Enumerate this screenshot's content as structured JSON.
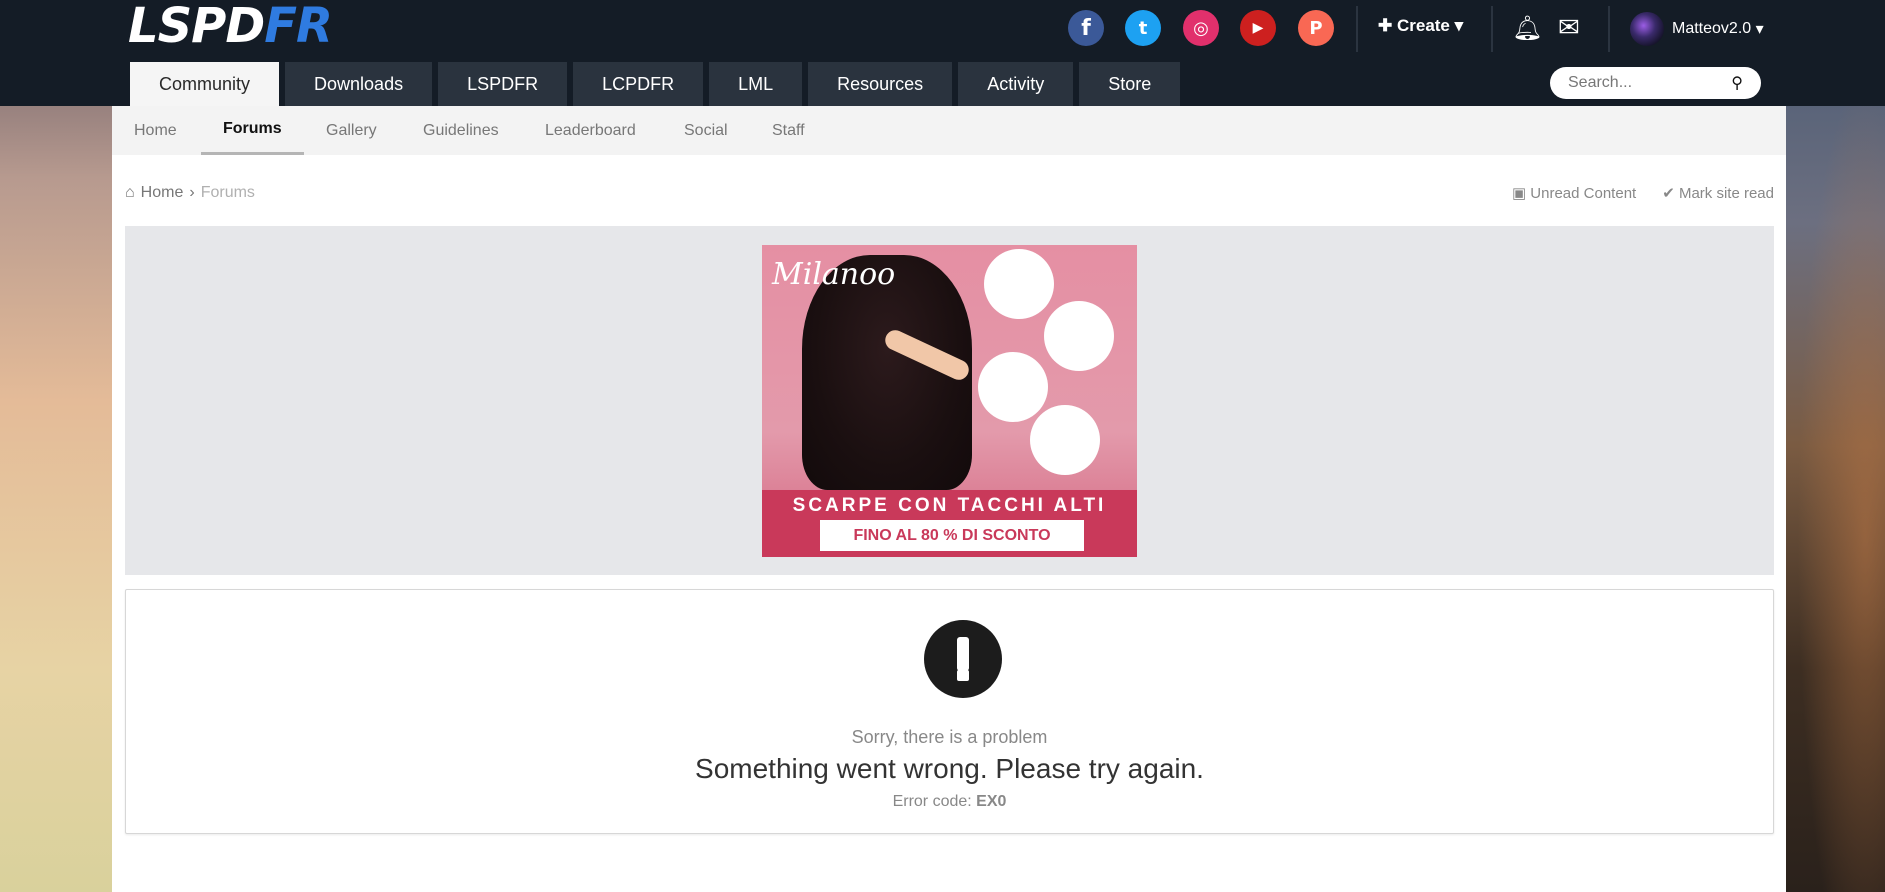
{
  "brand": {
    "part1": "LSPD",
    "part2": "FR"
  },
  "social": [
    {
      "name": "facebook-icon",
      "glyph": "f",
      "color": "#3b5998"
    },
    {
      "name": "twitter-icon",
      "glyph": "t",
      "color": "#1da1f2"
    },
    {
      "name": "instagram-icon",
      "glyph": "◎",
      "color": "#e1306c"
    },
    {
      "name": "youtube-icon",
      "glyph": "▶",
      "color": "#cd201f"
    },
    {
      "name": "patreon-icon",
      "glyph": "P",
      "color": "#f96854"
    }
  ],
  "header": {
    "create_label": "Create",
    "username": "Matteov2.0",
    "search_placeholder": "Search..."
  },
  "main_nav": [
    {
      "label": "Community"
    },
    {
      "label": "Downloads"
    },
    {
      "label": "LSPDFR"
    },
    {
      "label": "LCPDFR"
    },
    {
      "label": "LML"
    },
    {
      "label": "Resources"
    },
    {
      "label": "Activity"
    },
    {
      "label": "Store"
    }
  ],
  "sub_nav": [
    {
      "label": "Home"
    },
    {
      "label": "Forums"
    },
    {
      "label": "Gallery"
    },
    {
      "label": "Guidelines"
    },
    {
      "label": "Leaderboard"
    },
    {
      "label": "Social"
    },
    {
      "label": "Staff"
    }
  ],
  "breadcrumb": {
    "home": "Home",
    "current": "Forums"
  },
  "actions": {
    "unread": "Unread Content",
    "mark_read": "Mark site read"
  },
  "ad": {
    "brand": "Milanoo",
    "headline": "SCARPE CON TACCHI ALTI",
    "cta": "FINO AL 80 % DI SCONTO"
  },
  "error": {
    "heading": "Sorry, there is a problem",
    "message": "Something went wrong. Please try again.",
    "code_label": "Error code:",
    "code": "EX0"
  }
}
